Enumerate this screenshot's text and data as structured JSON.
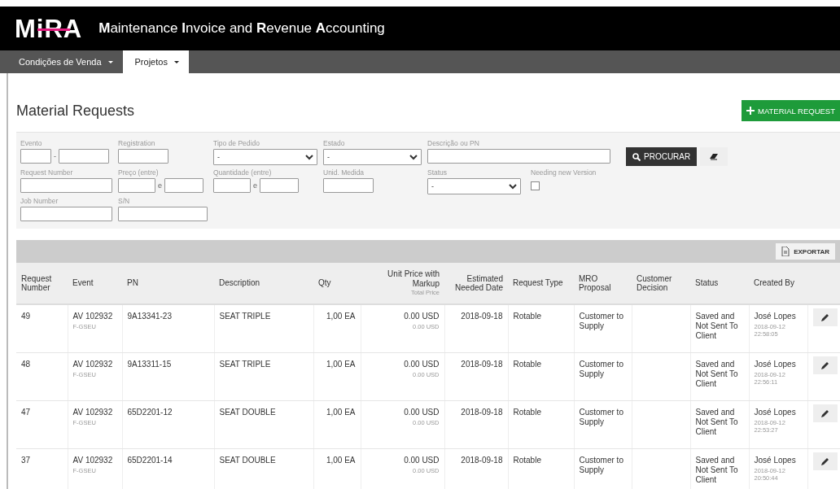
{
  "header": {
    "logo": "MiRA",
    "title": "**M**aintenance **I**nvoice and **R**evenue **A**ccounting"
  },
  "nav": {
    "tabs": [
      {
        "label": "Condições de Venda",
        "selected": false
      },
      {
        "label": "Projetos",
        "selected": true
      }
    ]
  },
  "page": {
    "title": "Material Requests",
    "new_button": "MATERIAL REQUEST"
  },
  "filters": {
    "rows": [
      [
        {
          "label": "Evento",
          "kind": "range",
          "separator": "-"
        },
        {
          "label": "Registration",
          "kind": "short"
        },
        {
          "label": "Tipo de Pedido",
          "kind": "select",
          "value": "-"
        },
        {
          "label": "Estado",
          "kind": "select",
          "value": "-"
        },
        {
          "label": "Descrição ou PN",
          "kind": "wide"
        }
      ],
      [
        {
          "label": "Request Number",
          "kind": "text"
        },
        {
          "label": "Preço (entre)",
          "kind": "range",
          "separator": "e"
        },
        {
          "label": "Quantidade (entre)",
          "kind": "range",
          "separator": "e"
        },
        {
          "label": "Unid. Medida",
          "kind": "short"
        },
        {
          "label": "Status",
          "kind": "select",
          "value": "-"
        },
        {
          "label": "Needing new Version",
          "kind": "checkbox",
          "checked": false
        }
      ],
      [
        {
          "label": "Job Number",
          "kind": "text"
        },
        {
          "label": "S/N",
          "kind": "text"
        }
      ]
    ],
    "search_button": "PROCURAR"
  },
  "table": {
    "export_button": "EXPORTAR",
    "columns": [
      {
        "label": "Request Number"
      },
      {
        "label": "Event"
      },
      {
        "label": "PN"
      },
      {
        "label": "Description"
      },
      {
        "label": "Qty"
      },
      {
        "label": "Unit Price with Markup",
        "sublabel": "Total Price"
      },
      {
        "label": "Estimated Needed Date"
      },
      {
        "label": "Request Type"
      },
      {
        "label": "MRO Proposal"
      },
      {
        "label": "Customer Decision"
      },
      {
        "label": "Status"
      },
      {
        "label": "Created By"
      }
    ],
    "rows": [
      {
        "request_number": "49",
        "event": "AV 102932",
        "registration": "F-GSEU",
        "pn": "9A13341-23",
        "description": "SEAT TRIPLE",
        "qty": "1,00 EA",
        "unit_price": "0.00 USD",
        "total_price": "0.00 USD",
        "date": "2018-09-18",
        "type": "Rotable",
        "proposal": "Customer to Supply",
        "status": "Saved and Not Sent To Client",
        "created_by": "José Lopes",
        "created_at": "2018-09-12 22:58:05"
      },
      {
        "request_number": "48",
        "event": "AV 102932",
        "registration": "F-GSEU",
        "pn": "9A13311-15",
        "description": "SEAT TRIPLE",
        "qty": "1,00 EA",
        "unit_price": "0.00 USD",
        "total_price": "0.00 USD",
        "date": "2018-09-18",
        "type": "Rotable",
        "proposal": "Customer to Supply",
        "status": "Saved and Not Sent To Client",
        "created_by": "José Lopes",
        "created_at": "2018-09-12 22:56:11"
      },
      {
        "request_number": "47",
        "event": "AV 102932",
        "registration": "F-GSEU",
        "pn": "65D2201-12",
        "description": "SEAT DOUBLE",
        "qty": "1,00 EA",
        "unit_price": "0.00 USD",
        "total_price": "0.00 USD",
        "date": "2018-09-18",
        "type": "Rotable",
        "proposal": "Customer to Supply",
        "status": "Saved and Not Sent To Client",
        "created_by": "José Lopes",
        "created_at": "2018-09-12 22:53:27"
      },
      {
        "request_number": "37",
        "event": "AV 102932",
        "registration": "F-GSEU",
        "pn": "65D2201-14",
        "description": "SEAT DOUBLE",
        "qty": "1,00 EA",
        "unit_price": "0.00 USD",
        "total_price": "0.00 USD",
        "date": "2018-09-18",
        "type": "Rotable",
        "proposal": "Customer to Supply",
        "status": "Saved and Not Sent To Client",
        "created_by": "José Lopes",
        "created_at": "2018-09-12 20:50:44"
      }
    ]
  }
}
